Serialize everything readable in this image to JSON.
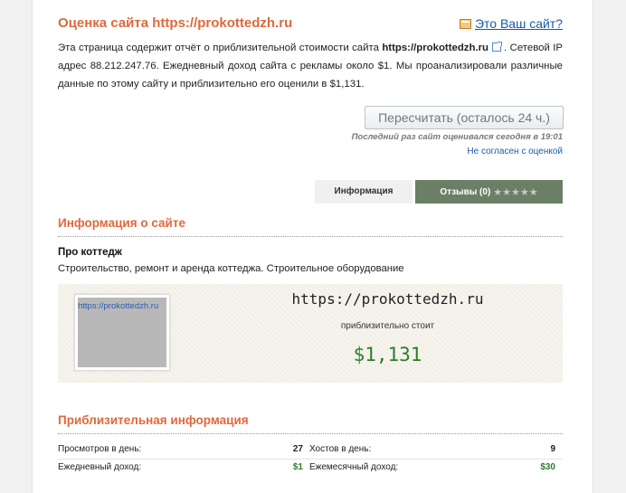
{
  "header": {
    "title": "Оценка сайта https://prokottedzh.ru",
    "own_site_link": "Это Ваш сайт?"
  },
  "intro": {
    "p1": "Эта страница содержит отчёт о приблизительной стоимости сайта ",
    "site": "https://prokottedzh.ru",
    "p2": ". Сетевой IP адрес 88.212.247.76. Ежедневный доход сайта с рекламы около $1. Мы проанализировали различные данные по этому сайту и приблизительно его оценили в $1,131."
  },
  "actions": {
    "recalc_label": "Пересчитать (осталось 24 ч.)",
    "last_evaluated": "Последний раз сайт оценивался сегодня в 19:01",
    "disagree_link": "Не согласен с оценкой"
  },
  "tabs": {
    "info": "Информация",
    "reviews": "Отзывы (0)",
    "stars": "★★★★★",
    "accent": "#6b7f66"
  },
  "site_info": {
    "section_title": "Информация о сайте",
    "about_title": "Про коттедж",
    "about_desc": "Строительство, ремонт и аренда коттеджа. Строительное оборудование"
  },
  "valuation": {
    "thumb_label": "https://prokottedzh.ru",
    "site": "https://prokottedzh.ru",
    "costs_label": "приблизительно стоит",
    "price": "$1,131",
    "price_color": "#2f7d2a"
  },
  "approx": {
    "section_title": "Приблизительная информация",
    "rows": [
      {
        "left_label": "Просмотров в день:",
        "left_value": "27",
        "right_label": "Хостов в день:",
        "right_value": "9"
      },
      {
        "left_label": "Ежедневный доход:",
        "left_value": "$1",
        "right_label": "Ежемесячный доход:",
        "right_value": "$30"
      }
    ]
  }
}
